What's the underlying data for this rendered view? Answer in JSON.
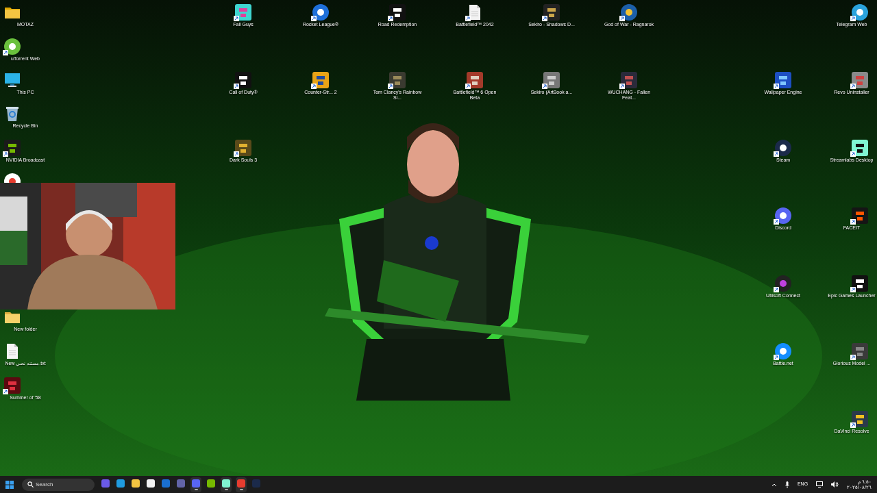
{
  "desktop": {
    "icons": [
      {
        "label": "MOTAZ",
        "shortcut": false
      },
      {
        "label": "Fall Guys",
        "shortcut": true
      },
      {
        "label": "Rocket League®",
        "shortcut": true
      },
      {
        "label": "Road Redemption",
        "shortcut": true
      },
      {
        "label": "Battlefield™ 2042",
        "shortcut": true
      },
      {
        "label": "Sekiro - Shadows D...",
        "shortcut": true
      },
      {
        "label": "God of War - Ragnarok",
        "shortcut": true
      },
      {
        "label": "Telegram Web",
        "shortcut": true
      },
      {
        "label": "uTorrent Web",
        "shortcut": true
      },
      {
        "label": "This PC",
        "shortcut": false
      },
      {
        "label": "Call of Duty®",
        "shortcut": true
      },
      {
        "label": "Counter-Str... 2",
        "shortcut": true
      },
      {
        "label": "Tom Clancy's Rainbow Si...",
        "shortcut": true
      },
      {
        "label": "Battlefield™ 6 Open Beta",
        "shortcut": true
      },
      {
        "label": "Sekiro (ArtBook a...",
        "shortcut": true
      },
      {
        "label": "WUCHANG - Fallen Feat...",
        "shortcut": true
      },
      {
        "label": "Wallpaper Engine",
        "shortcut": true
      },
      {
        "label": "Revo Uninstaller",
        "shortcut": true
      },
      {
        "label": "Recycle Bin",
        "shortcut": false
      },
      {
        "label": "NVIDIA Broadcast",
        "shortcut": true
      },
      {
        "label": "Dark Souls 3",
        "shortcut": true
      },
      {
        "label": "Steam",
        "shortcut": true
      },
      {
        "label": "Streamlabs Desktop",
        "shortcut": true
      },
      {
        "shortcut": false
      },
      {
        "label": "Discord",
        "shortcut": true
      },
      {
        "label": "FACEIT",
        "shortcut": true
      },
      {
        "label": "Ubisoft Connect",
        "shortcut": true
      },
      {
        "label": "Epic Games Launcher",
        "shortcut": true
      },
      {
        "label": "New folder",
        "shortcut": false
      },
      {
        "label": "New مستند نصي.txt",
        "shortcut": false
      },
      {
        "label": "Battle.net",
        "shortcut": true
      },
      {
        "label": "Glorious Model ...",
        "shortcut": true
      },
      {
        "label": "Summer of '58",
        "shortcut": true
      },
      {
        "label": "DaVinci Resolve",
        "shortcut": true
      }
    ]
  },
  "taskbar": {
    "search": {
      "placeholder": "Search"
    },
    "apps": [
      {
        "active": false
      },
      {
        "active": false
      },
      {
        "active": false
      },
      {
        "active": false
      },
      {
        "active": false
      },
      {
        "active": false
      },
      {
        "active": true
      },
      {
        "active": false
      },
      {
        "active": true
      },
      {
        "active": true
      },
      {
        "active": false
      }
    ],
    "language": "ENG",
    "time": "٦:٥٠ م",
    "date": "٢٠٢٥/٠٨/٢٦"
  }
}
